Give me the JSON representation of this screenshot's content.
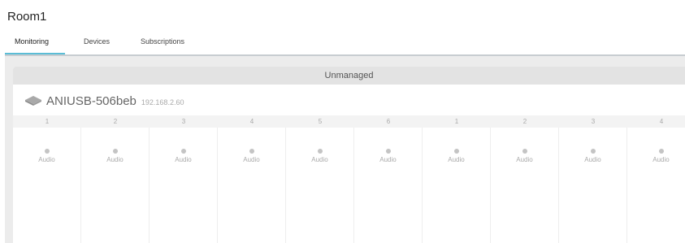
{
  "room": {
    "title": "Room1"
  },
  "tabs": [
    {
      "label": "Monitoring",
      "active": true
    },
    {
      "label": "Devices",
      "active": false
    },
    {
      "label": "Subscriptions",
      "active": false
    }
  ],
  "group": {
    "label": "Unmanaged"
  },
  "device": {
    "name": "ANIUSB-506beb",
    "ip": "192.168.2.60",
    "icon": "device-icon"
  },
  "channels": [
    {
      "number": "1",
      "type": "Audio"
    },
    {
      "number": "2",
      "type": "Audio"
    },
    {
      "number": "3",
      "type": "Audio"
    },
    {
      "number": "4",
      "type": "Audio"
    },
    {
      "number": "5",
      "type": "Audio"
    },
    {
      "number": "6",
      "type": "Audio"
    },
    {
      "number": "1",
      "type": "Audio"
    },
    {
      "number": "2",
      "type": "Audio"
    },
    {
      "number": "3",
      "type": "Audio"
    },
    {
      "number": "4",
      "type": "Audio"
    }
  ],
  "colors": {
    "accent": "#5bbdd6",
    "dot": "#c4c4c4"
  }
}
